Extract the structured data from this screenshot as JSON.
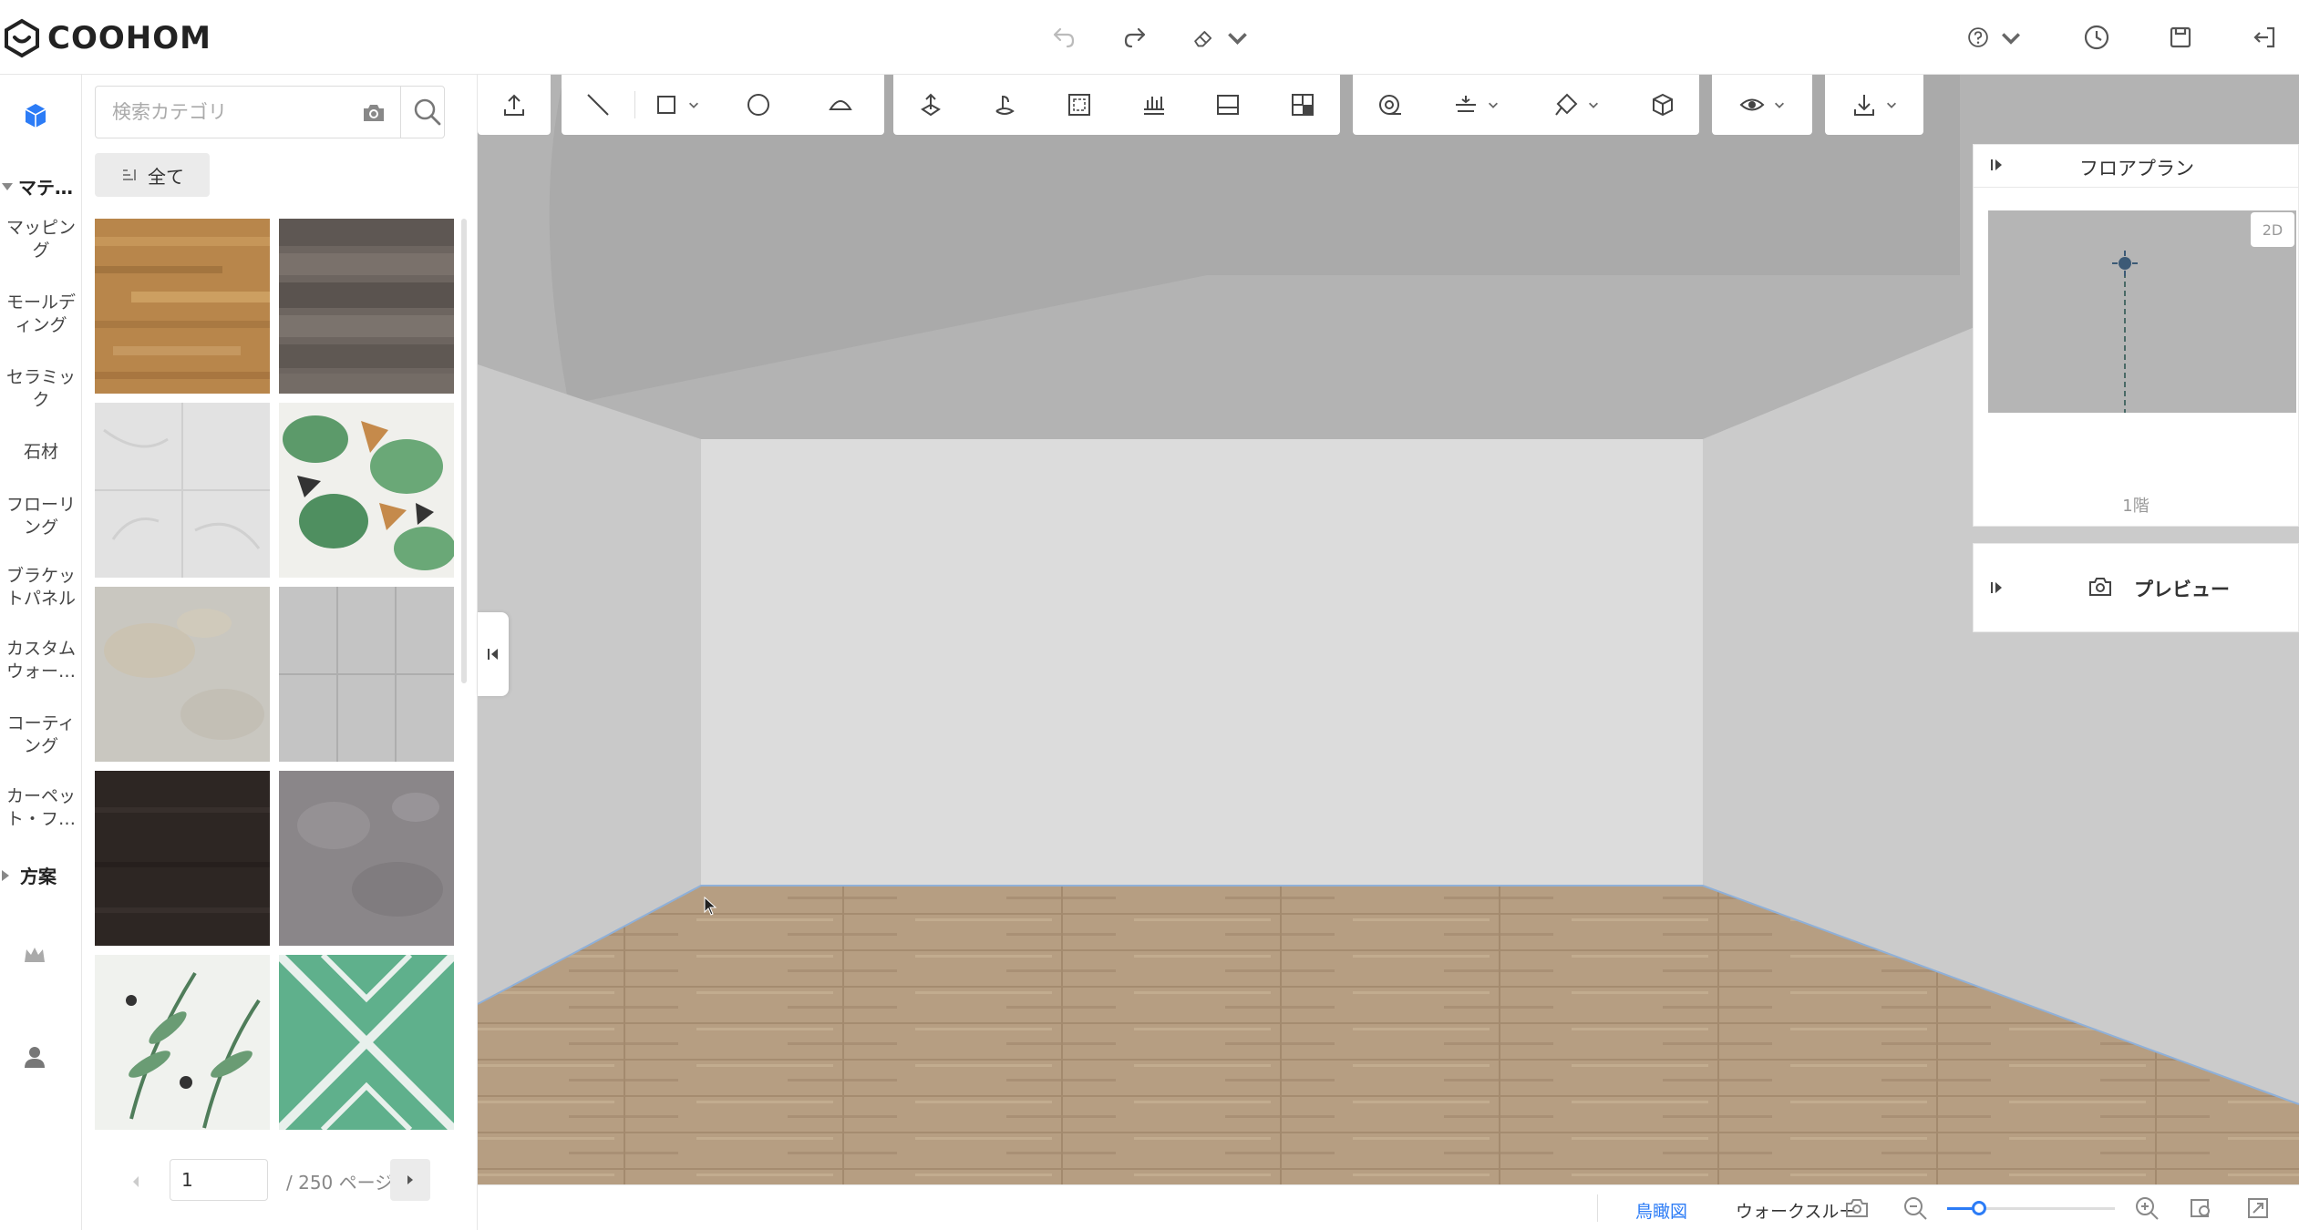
{
  "app": {
    "logo_text": "COOHOM"
  },
  "colors": {
    "accent": "#2c7cf6",
    "floor": "#b69e82",
    "back_wall": "#dcdcdc",
    "ceiling": "#b3b3b3"
  },
  "topbar": {
    "center_icons": [
      "undo-icon",
      "redo-icon",
      "eraser-icon"
    ],
    "right_icons": [
      "help-icon",
      "history-icon",
      "save-icon",
      "exit-icon"
    ]
  },
  "rail": {
    "section_materials": "マテ…",
    "items": [
      "マッピング",
      "モールディング",
      "セラミック",
      "石材",
      "フローリング",
      "ブラケットパネル",
      "カスタムウォー…",
      "コーティング",
      "カーペット・フ…"
    ],
    "section_plans": "方案"
  },
  "catalog": {
    "search_placeholder": "検索カテゴリ",
    "filter_label": "全て",
    "tiles": [
      "wood-amber",
      "wood-dark-grey",
      "marble-white",
      "tropical-leaves",
      "stone-beige",
      "grey-tile",
      "dark-wood",
      "grey-concrete",
      "fern-leaves",
      "green-geometric"
    ],
    "page_value": "1",
    "page_total": "/ 250 ページ"
  },
  "toolbar": {
    "groups": [
      [
        "upload-icon"
      ],
      [
        "line-icon",
        "rectangle-icon",
        "circle-icon",
        "arc-icon"
      ],
      [
        "extrude-icon",
        "push-pull-icon",
        "frame-select-icon",
        "level-icon",
        "panel-icon",
        "quad-icon"
      ],
      [
        "tape-measure-icon",
        "align-icon",
        "paint-icon",
        "box-icon"
      ],
      [
        "eye-icon"
      ],
      [
        "download-icon"
      ]
    ]
  },
  "floorplan": {
    "title": "フロアプラン",
    "badge": "2D",
    "floor_label": "1階"
  },
  "preview": {
    "title": "プレビュー"
  },
  "bottombar": {
    "view_aerial": "鳥瞰図",
    "view_walk": "ウォークスルー",
    "zoom_level": 0.19
  }
}
